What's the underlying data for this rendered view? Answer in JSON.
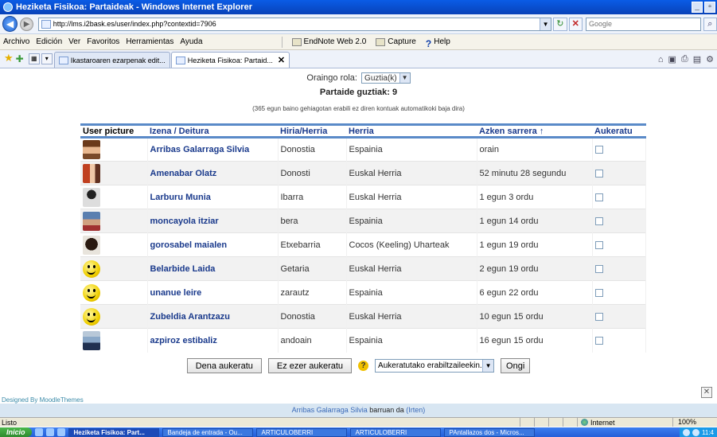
{
  "window": {
    "title": "Heziketa Fisikoa: Partaideak - Windows Internet Explorer"
  },
  "address": {
    "url": "http://lms.i2bask.es/user/index.php?contextid=7906",
    "search_placeholder": "Google"
  },
  "menu": {
    "items": [
      "Archivo",
      "Edición",
      "Ver",
      "Favoritos",
      "Herramientas",
      "Ayuda"
    ],
    "toolbar": [
      "EndNote Web 2.0",
      "Capture",
      "Help"
    ]
  },
  "tabs": [
    {
      "label": "Ikastaroaren ezarpenak edit..."
    },
    {
      "label": "Heziketa Fisikoa: Partaid..."
    }
  ],
  "page": {
    "role_label": "Oraingo rola:",
    "role_value": "Guztia(k)",
    "count": "Partaide guztiak: 9",
    "note": "(365 egun baino gehiagotan erabili ez diren kontuak automatikoki baja dira)",
    "columns": {
      "picture": "User picture",
      "name": "Izena / Deitura",
      "city": "Hiria/Herria",
      "country": "Herria",
      "last": "Azken sarrera ↑",
      "select": "Aukeratu"
    },
    "rows": [
      {
        "name": "Arribas Galarraga Silvia",
        "city": "Donostia",
        "country": "Espainia",
        "last": "orain",
        "avatar": "photo-1"
      },
      {
        "name": "Amenabar Olatz",
        "city": "Donosti",
        "country": "Euskal Herria",
        "last": "52 minutu 28 segundu",
        "avatar": "photo-2"
      },
      {
        "name": "Larburu Munia",
        "city": "Ibarra",
        "country": "Euskal Herria",
        "last": "1 egun 3 ordu",
        "avatar": "photo-3"
      },
      {
        "name": "moncayola itziar",
        "city": "bera",
        "country": "Espainia",
        "last": "1 egun 14 ordu",
        "avatar": "photo-4"
      },
      {
        "name": "gorosabel maialen",
        "city": "Etxebarria",
        "country": "Cocos (Keeling) Uharteak",
        "last": "1 egun 19 ordu",
        "avatar": "photo-5"
      },
      {
        "name": "Belarbide Laida",
        "city": "Getaria",
        "country": "Euskal Herria",
        "last": "2 egun 19 ordu",
        "avatar": "smiley"
      },
      {
        "name": "unanue leire",
        "city": "zarautz",
        "country": "Espainia",
        "last": "6 egun 22 ordu",
        "avatar": "smiley"
      },
      {
        "name": "Zubeldia Arantzazu",
        "city": "Donostia",
        "country": "Euskal Herria",
        "last": "10 egun 15 ordu",
        "avatar": "smiley"
      },
      {
        "name": "azpiroz estibaliz",
        "city": "andoain",
        "country": "Espainia",
        "last": "16 egun 15 ordu",
        "avatar": "photo-6"
      }
    ],
    "select_all": "Dena aukeratu",
    "select_none": "Ez ezer aukeratu",
    "action_select": "Aukeratutako erabiltzaileekin...",
    "go": "Ongi",
    "designed_by": "Designed By MoodleThemes",
    "logged_user": "Arribas Galarraga Silvia",
    "logged_text": "barruan da",
    "logout": "(Irten)"
  },
  "status": {
    "left": "Listo",
    "zone": "Internet",
    "zoom": "100%"
  },
  "taskbar": {
    "start": "Inicio",
    "tasks": [
      "Heziketa Fisikoa: Part...",
      "Bandeja de entrada - Ou...",
      "ARTICULOBERRI",
      "ARTICULOBERRI",
      "PAntallazos dos - Micros..."
    ],
    "clock": "11:4"
  }
}
